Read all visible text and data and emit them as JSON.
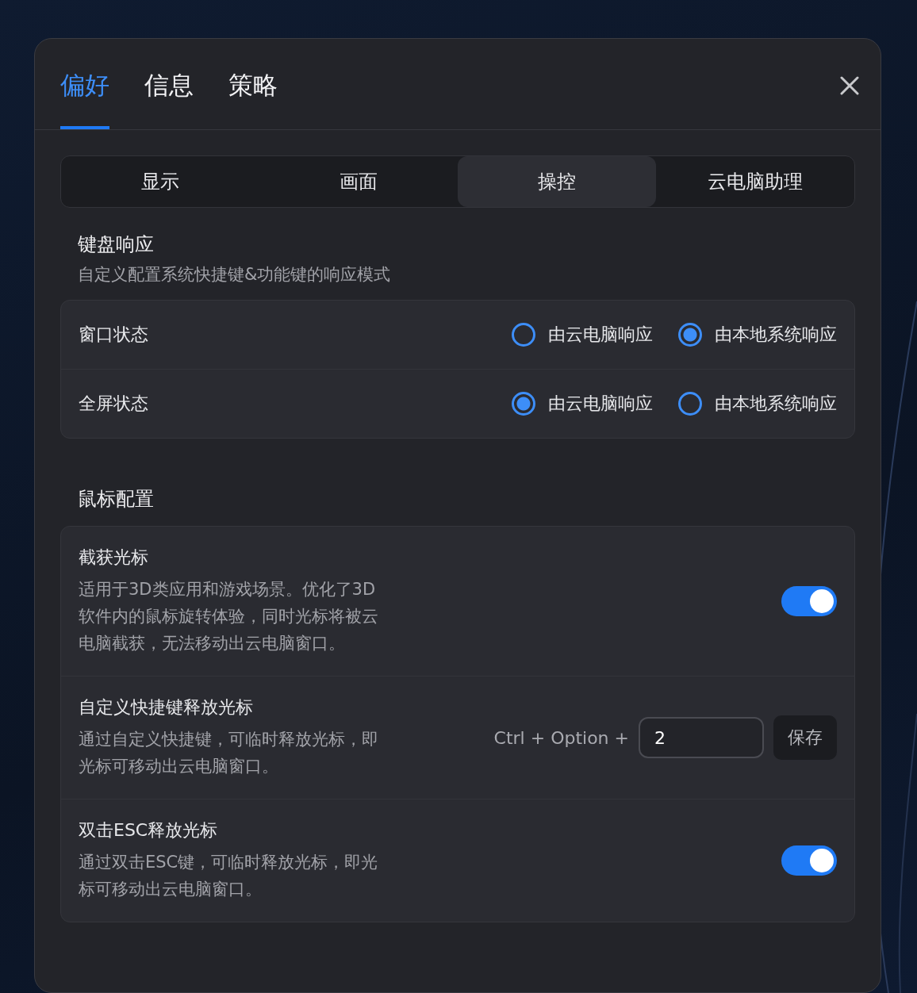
{
  "tabs": [
    {
      "label": "偏好",
      "selected": true
    },
    {
      "label": "信息",
      "selected": false
    },
    {
      "label": "策略",
      "selected": false
    }
  ],
  "segments": [
    {
      "label": "显示",
      "selected": false
    },
    {
      "label": "画面",
      "selected": false
    },
    {
      "label": "操控",
      "selected": true
    },
    {
      "label": "云电脑助理",
      "selected": false
    }
  ],
  "sections": [
    {
      "title": "键盘响应",
      "subtitle": "自定义配置系统快捷键&功能键的响应模式",
      "rows": [
        {
          "kind": "radio",
          "label": "窗口状态",
          "options": [
            {
              "label": "由云电脑响应",
              "selected": false
            },
            {
              "label": "由本地系统响应",
              "selected": true
            }
          ]
        },
        {
          "kind": "radio",
          "label": "全屏状态",
          "options": [
            {
              "label": "由云电脑响应",
              "selected": true
            },
            {
              "label": "由本地系统响应",
              "selected": false
            }
          ]
        }
      ]
    },
    {
      "title": "鼠标配置",
      "rows": [
        {
          "kind": "toggle",
          "title": "截获光标",
          "description": "适用于3D类应用和游戏场景。优化了3D软件内的鼠标旋转体验，同时光标将被云电脑截获，无法移动出云电脑窗口。",
          "on": true
        },
        {
          "kind": "shortcut",
          "title": "自定义快捷键释放光标",
          "description": "通过自定义快捷键，可临时释放光标，即光标可移动出云电脑窗口。",
          "prefix": "Ctrl + Option +",
          "value": "2",
          "button": "保存"
        },
        {
          "kind": "toggle",
          "title": "双击ESC释放光标",
          "description": "通过双击ESC键，可临时释放光标，即光标可移动出云电脑窗口。",
          "on": true
        }
      ]
    }
  ]
}
